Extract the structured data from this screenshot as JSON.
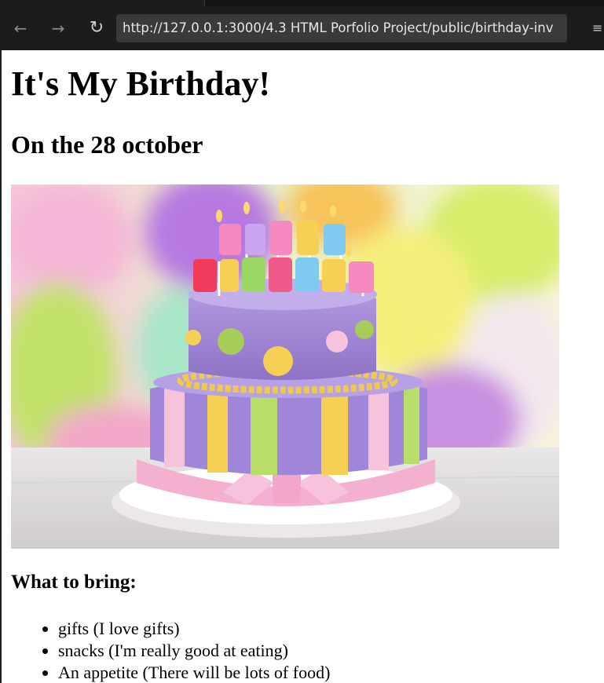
{
  "browser": {
    "url": "http://127.0.0.1:3000/4.3 HTML Porfolio Project/public/birthday-inv",
    "icons": {
      "back": "arrow-left-icon",
      "forward": "arrow-right-icon",
      "reload": "reload-icon",
      "menu": "menu-icon"
    }
  },
  "page": {
    "title": "It's My Birthday!",
    "date_line": "On the 28 october",
    "image": {
      "subject": "cake"
    },
    "bring_heading": "What to bring:",
    "bring_items": [
      "gifts (I love gifts)",
      "snacks (I'm really good at eating)",
      "An appetite (There will be lots of food)"
    ]
  },
  "colors": {
    "browser_chrome": "#1c1c1c",
    "urlbar_bg": "#3a3a3a",
    "page_bg": "#ffffff",
    "cake_top": "#9b7fd2",
    "cake_frosting_pink": "#f4b0cf"
  }
}
